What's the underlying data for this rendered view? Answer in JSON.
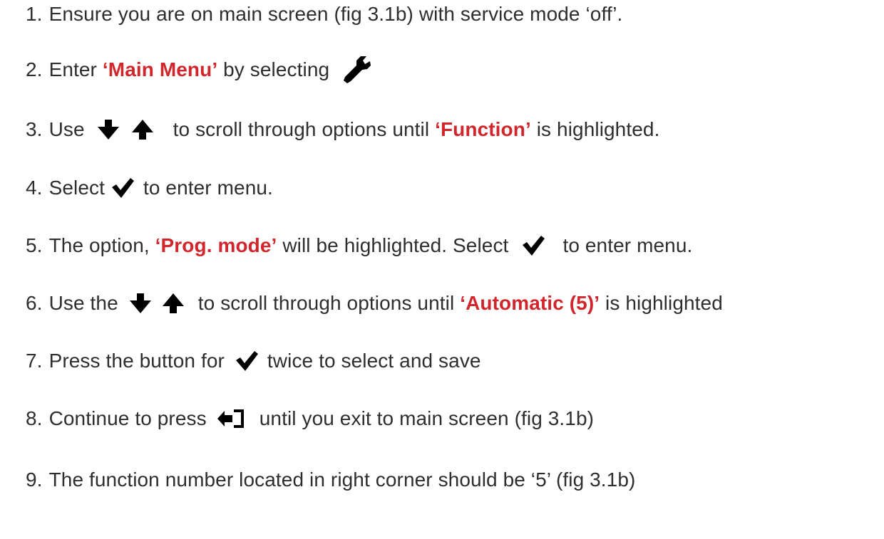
{
  "colors": {
    "text": "#2e2e2e",
    "highlight": "#d1262b",
    "icon": "#000000"
  },
  "steps": [
    {
      "num": "1.",
      "parts": [
        "Ensure you are on main screen (fig 3.1b) with service mode ‘off’."
      ]
    },
    {
      "num": "2.",
      "parts": [
        "Enter",
        "‘Main Menu’",
        "by selecting"
      ],
      "icon": "wrench-icon"
    },
    {
      "num": "3.",
      "parts": [
        "Use",
        "to scroll through options until",
        "‘Function’",
        "is highlighted."
      ],
      "icons": [
        "arrow-down-icon",
        "arrow-up-icon"
      ]
    },
    {
      "num": "4.",
      "parts": [
        "Select",
        "to enter menu."
      ],
      "icon": "checkmark-icon"
    },
    {
      "num": "5.",
      "parts": [
        "The option,",
        "‘Prog. mode’",
        "will be highlighted. Select",
        "to enter menu."
      ],
      "icon": "checkmark-icon"
    },
    {
      "num": "6.",
      "parts": [
        "Use the",
        "to scroll through options until",
        "‘Automatic (5)’",
        "is highlighted"
      ],
      "icons": [
        "arrow-down-icon",
        "arrow-up-icon"
      ]
    },
    {
      "num": "7.",
      "parts": [
        "Press the button for",
        "twice to select and save"
      ],
      "icon": "checkmark-icon"
    },
    {
      "num": "8.",
      "parts": [
        "Continue to press",
        "until you exit to main screen (fig 3.1b)"
      ],
      "icon": "exit-icon"
    },
    {
      "num": "9.",
      "parts": [
        "The function number located in right corner should be ‘5’ (fig 3.1b)"
      ]
    }
  ]
}
